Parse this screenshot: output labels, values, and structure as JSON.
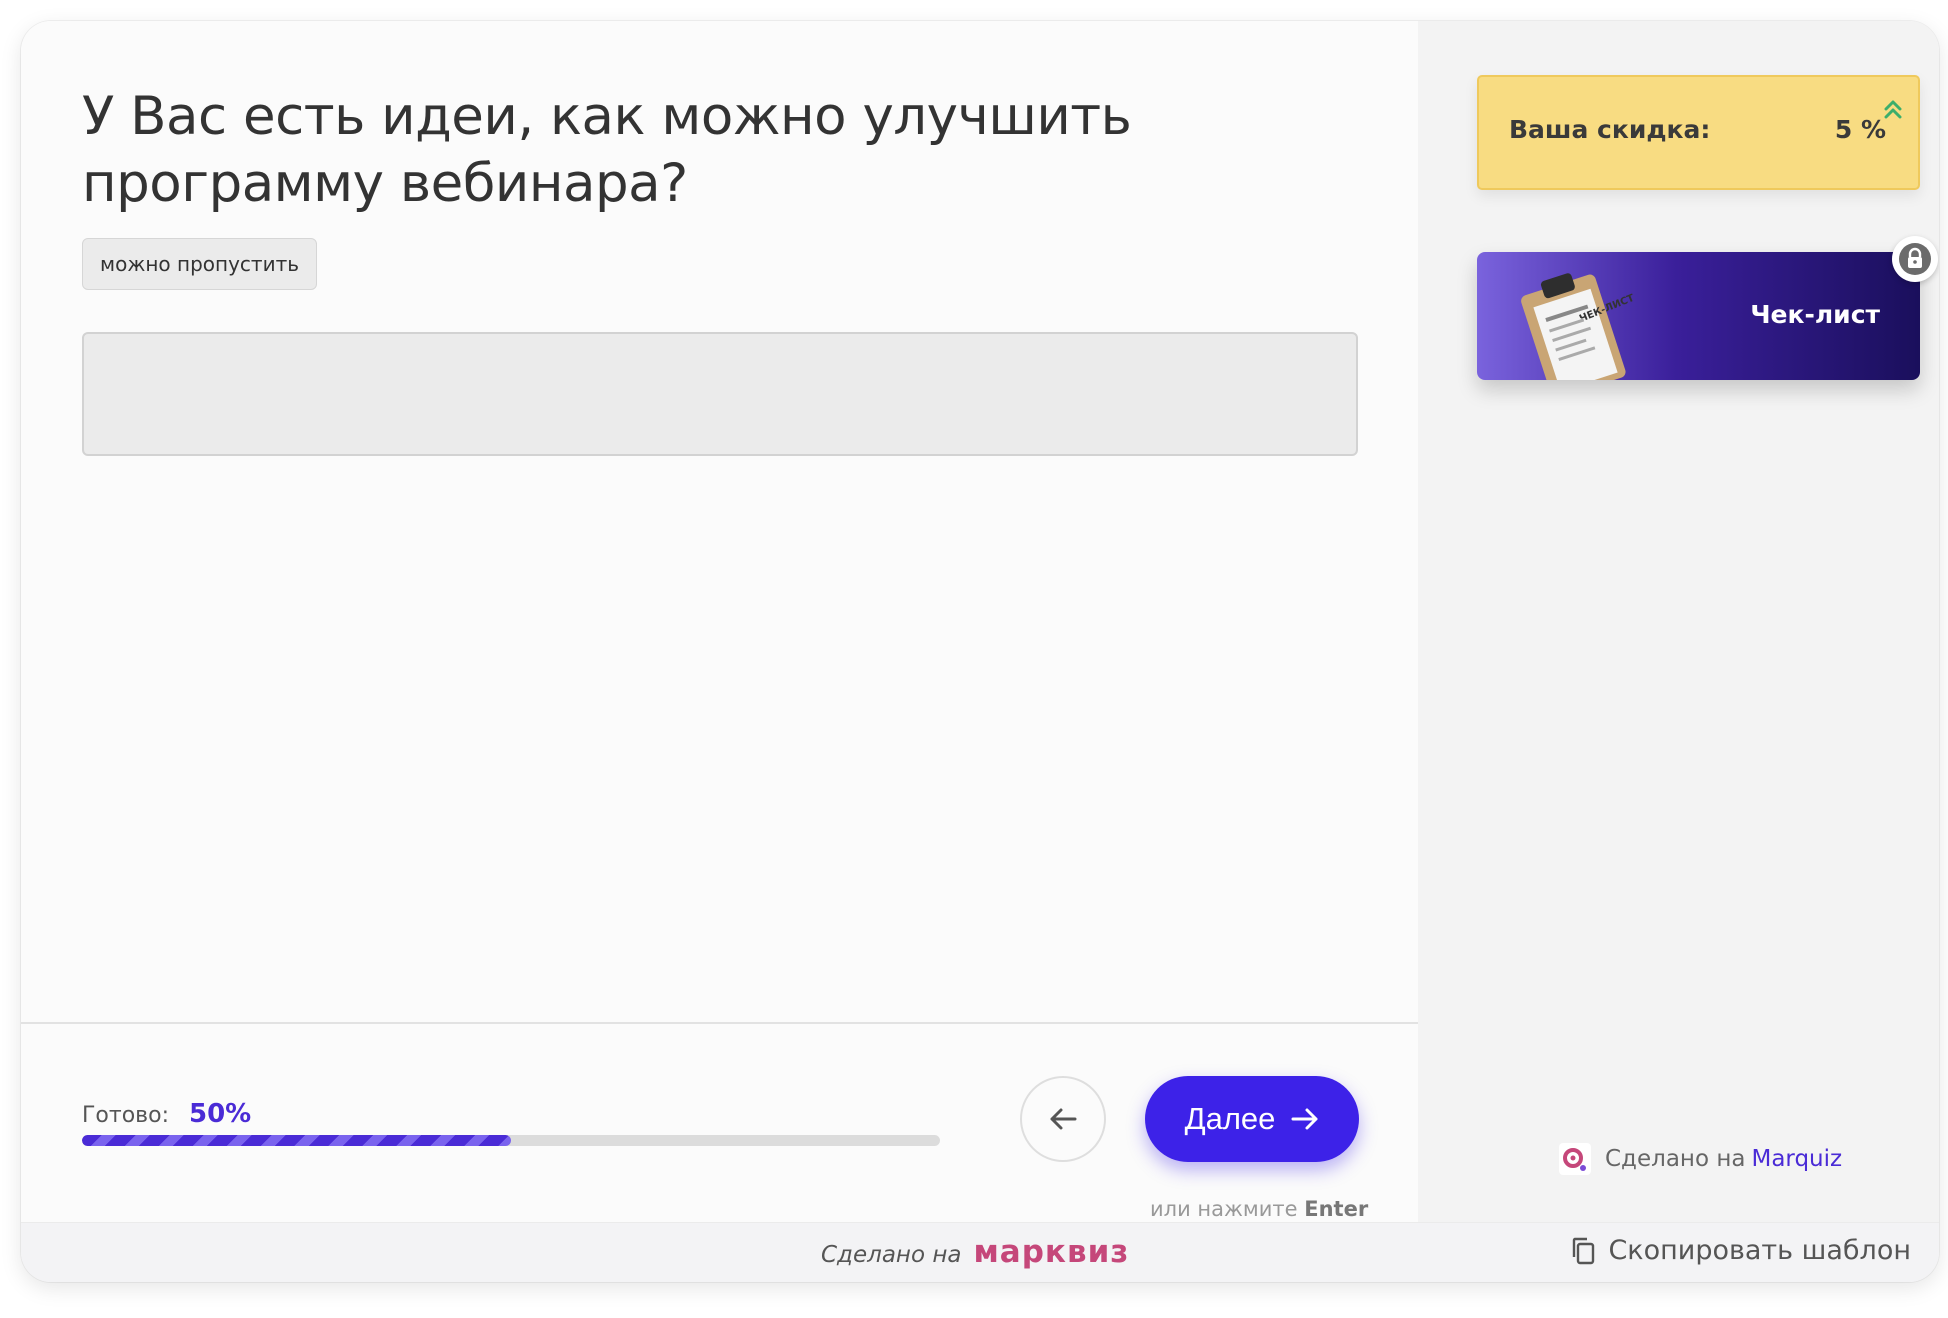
{
  "question": {
    "title": "У Вас есть идеи, как можно улучшить программу вебинара?",
    "skip_badge": "можно пропустить",
    "answer_value": "",
    "answer_placeholder": ""
  },
  "progress": {
    "label": "Готово:",
    "value_text": "50%",
    "fraction": 0.5
  },
  "navigation": {
    "back_icon": "arrow-left-icon",
    "next_label": "Далее",
    "next_icon": "arrow-right-icon",
    "enter_hint_prefix": "или нажмите",
    "enter_hint_key": "Enter"
  },
  "sidebar": {
    "discount_label": "Ваша скидка:",
    "discount_value": "5 %",
    "discount_icon": "double-chevron-up-icon",
    "bonus_title": "Чек-лист",
    "bonus_image_text": "ЧЕК-ЛИСТ",
    "lock_icon": "lock-icon",
    "credit_prefix": "Сделано на",
    "credit_brand": "Marquiz"
  },
  "footer": {
    "made_on": "Сделано на",
    "brand": "марквиз",
    "copy_template": "Скопировать шаблон"
  },
  "colors": {
    "accent": "#3d22e8",
    "progress": "#4a2bd6",
    "discount_bg": "#f8dc82",
    "brand_pink": "#c5477a",
    "chevron_green": "#3cae6b"
  }
}
